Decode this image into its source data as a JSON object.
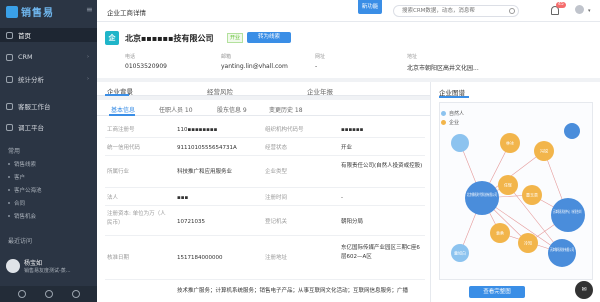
{
  "sidebar": {
    "brand": "销售易",
    "items": [
      {
        "label": "首页",
        "icon": "home-icon"
      },
      {
        "label": "CRM",
        "icon": "crm-icon"
      },
      {
        "label": "统计分析",
        "icon": "chart-icon"
      },
      {
        "label": "客服工作台",
        "icon": "service-icon"
      },
      {
        "label": "调工平台",
        "icon": "platform-icon"
      }
    ],
    "section_common": "常用",
    "common_items": [
      "销售线索",
      "客户",
      "客户公海池",
      "合同",
      "销售机会"
    ],
    "section_recent": "最近访问",
    "recent": {
      "name": "杨宝如",
      "sub": "销售易友度测试-蒸..."
    }
  },
  "topbar": {
    "title": "企业工商详情",
    "new_badge": "新功能",
    "search_placeholder": "搜索CRM数据，动态，消息帮",
    "notification_count": "45"
  },
  "company": {
    "name": "北京▪▪▪▪▪▪技有限公司",
    "status_tag": "开业",
    "follow_button": "转为线索",
    "fields": [
      {
        "label": "电话",
        "value": "01053520909"
      },
      {
        "label": "邮箱",
        "value": "yanting.lin@vhall.com"
      },
      {
        "label": "网址",
        "value": "-"
      },
      {
        "label": "地址",
        "value": "北京市朝阳区高井文化园..."
      }
    ]
  },
  "tabs": {
    "main": [
      "企业背景",
      "经营风险",
      "企业年报"
    ],
    "sub": [
      "基本信息",
      "任职人员 10",
      "股东信息 9",
      "变更历史 18"
    ]
  },
  "info_rows": [
    {
      "l1": "工商注册号",
      "v1": "110▪▪▪▪▪▪▪▪",
      "l2": "组织机构代码号",
      "v2": "▪▪▪▪▪▪"
    },
    {
      "l1": "统一信用代码",
      "v1": "9111010555654731A",
      "l2": "经营状态",
      "v2": "开业"
    },
    {
      "l1": "所属行业",
      "v1": "科技推广和应用服务业",
      "l2": "企业类型",
      "v2": "有限责任公司(自然人投资或控股)"
    },
    {
      "l1": "法人",
      "v1": "▪▪▪",
      "l2": "注册时间",
      "v2": "-"
    },
    {
      "l1": "注册资本: 单位为万（人民币）",
      "v1": "10721035",
      "l2": "登记机关",
      "v2": "朝阳分局"
    },
    {
      "l1": "核准日期",
      "v1": "1517184000000",
      "l2": "注册地址",
      "v2": "东亿国际传媒产业园区三期C座6层602—A区"
    },
    {
      "l1": "",
      "v1": "技术推广服务；计算机系统服务；销售电子产品；从事互联网文化活动；互联网信息服务；广播",
      "l2": "",
      "v2": ""
    }
  ],
  "graph": {
    "title": "企业图谱",
    "legend": [
      {
        "label": "自然人",
        "color": "#8cc3ef"
      },
      {
        "label": "企业",
        "color": "#f2b54b"
      }
    ],
    "nodes": [
      {
        "label": "北京微吼时代科技有限公司",
        "color": "#4a8ddb"
      },
      {
        "label": "天津微吼科技有限公司",
        "color": "#4a8ddb"
      },
      {
        "label": "天津微吼通讯科技有限公司",
        "color": "#4a8ddb"
      },
      {
        "label": "天津吼吼科技中心（有限合伙）",
        "color": "#4a8ddb"
      },
      {
        "label": "吼吼文化（天津）有限公司",
        "color": "#4a8ddb"
      },
      {
        "label": "林冰",
        "color": "#f2b54b"
      },
      {
        "label": "冯锐",
        "color": "#f2b54b"
      },
      {
        "label": "任辉",
        "color": "#f2b54b"
      },
      {
        "label": "董玉贵",
        "color": "#f2b54b"
      },
      {
        "label": "袁勇",
        "color": "#f2b54b"
      },
      {
        "label": "冷知",
        "color": "#f2b54b"
      },
      {
        "label": "童如白",
        "color": "#f2b54b"
      }
    ],
    "button": "查看完整图"
  }
}
